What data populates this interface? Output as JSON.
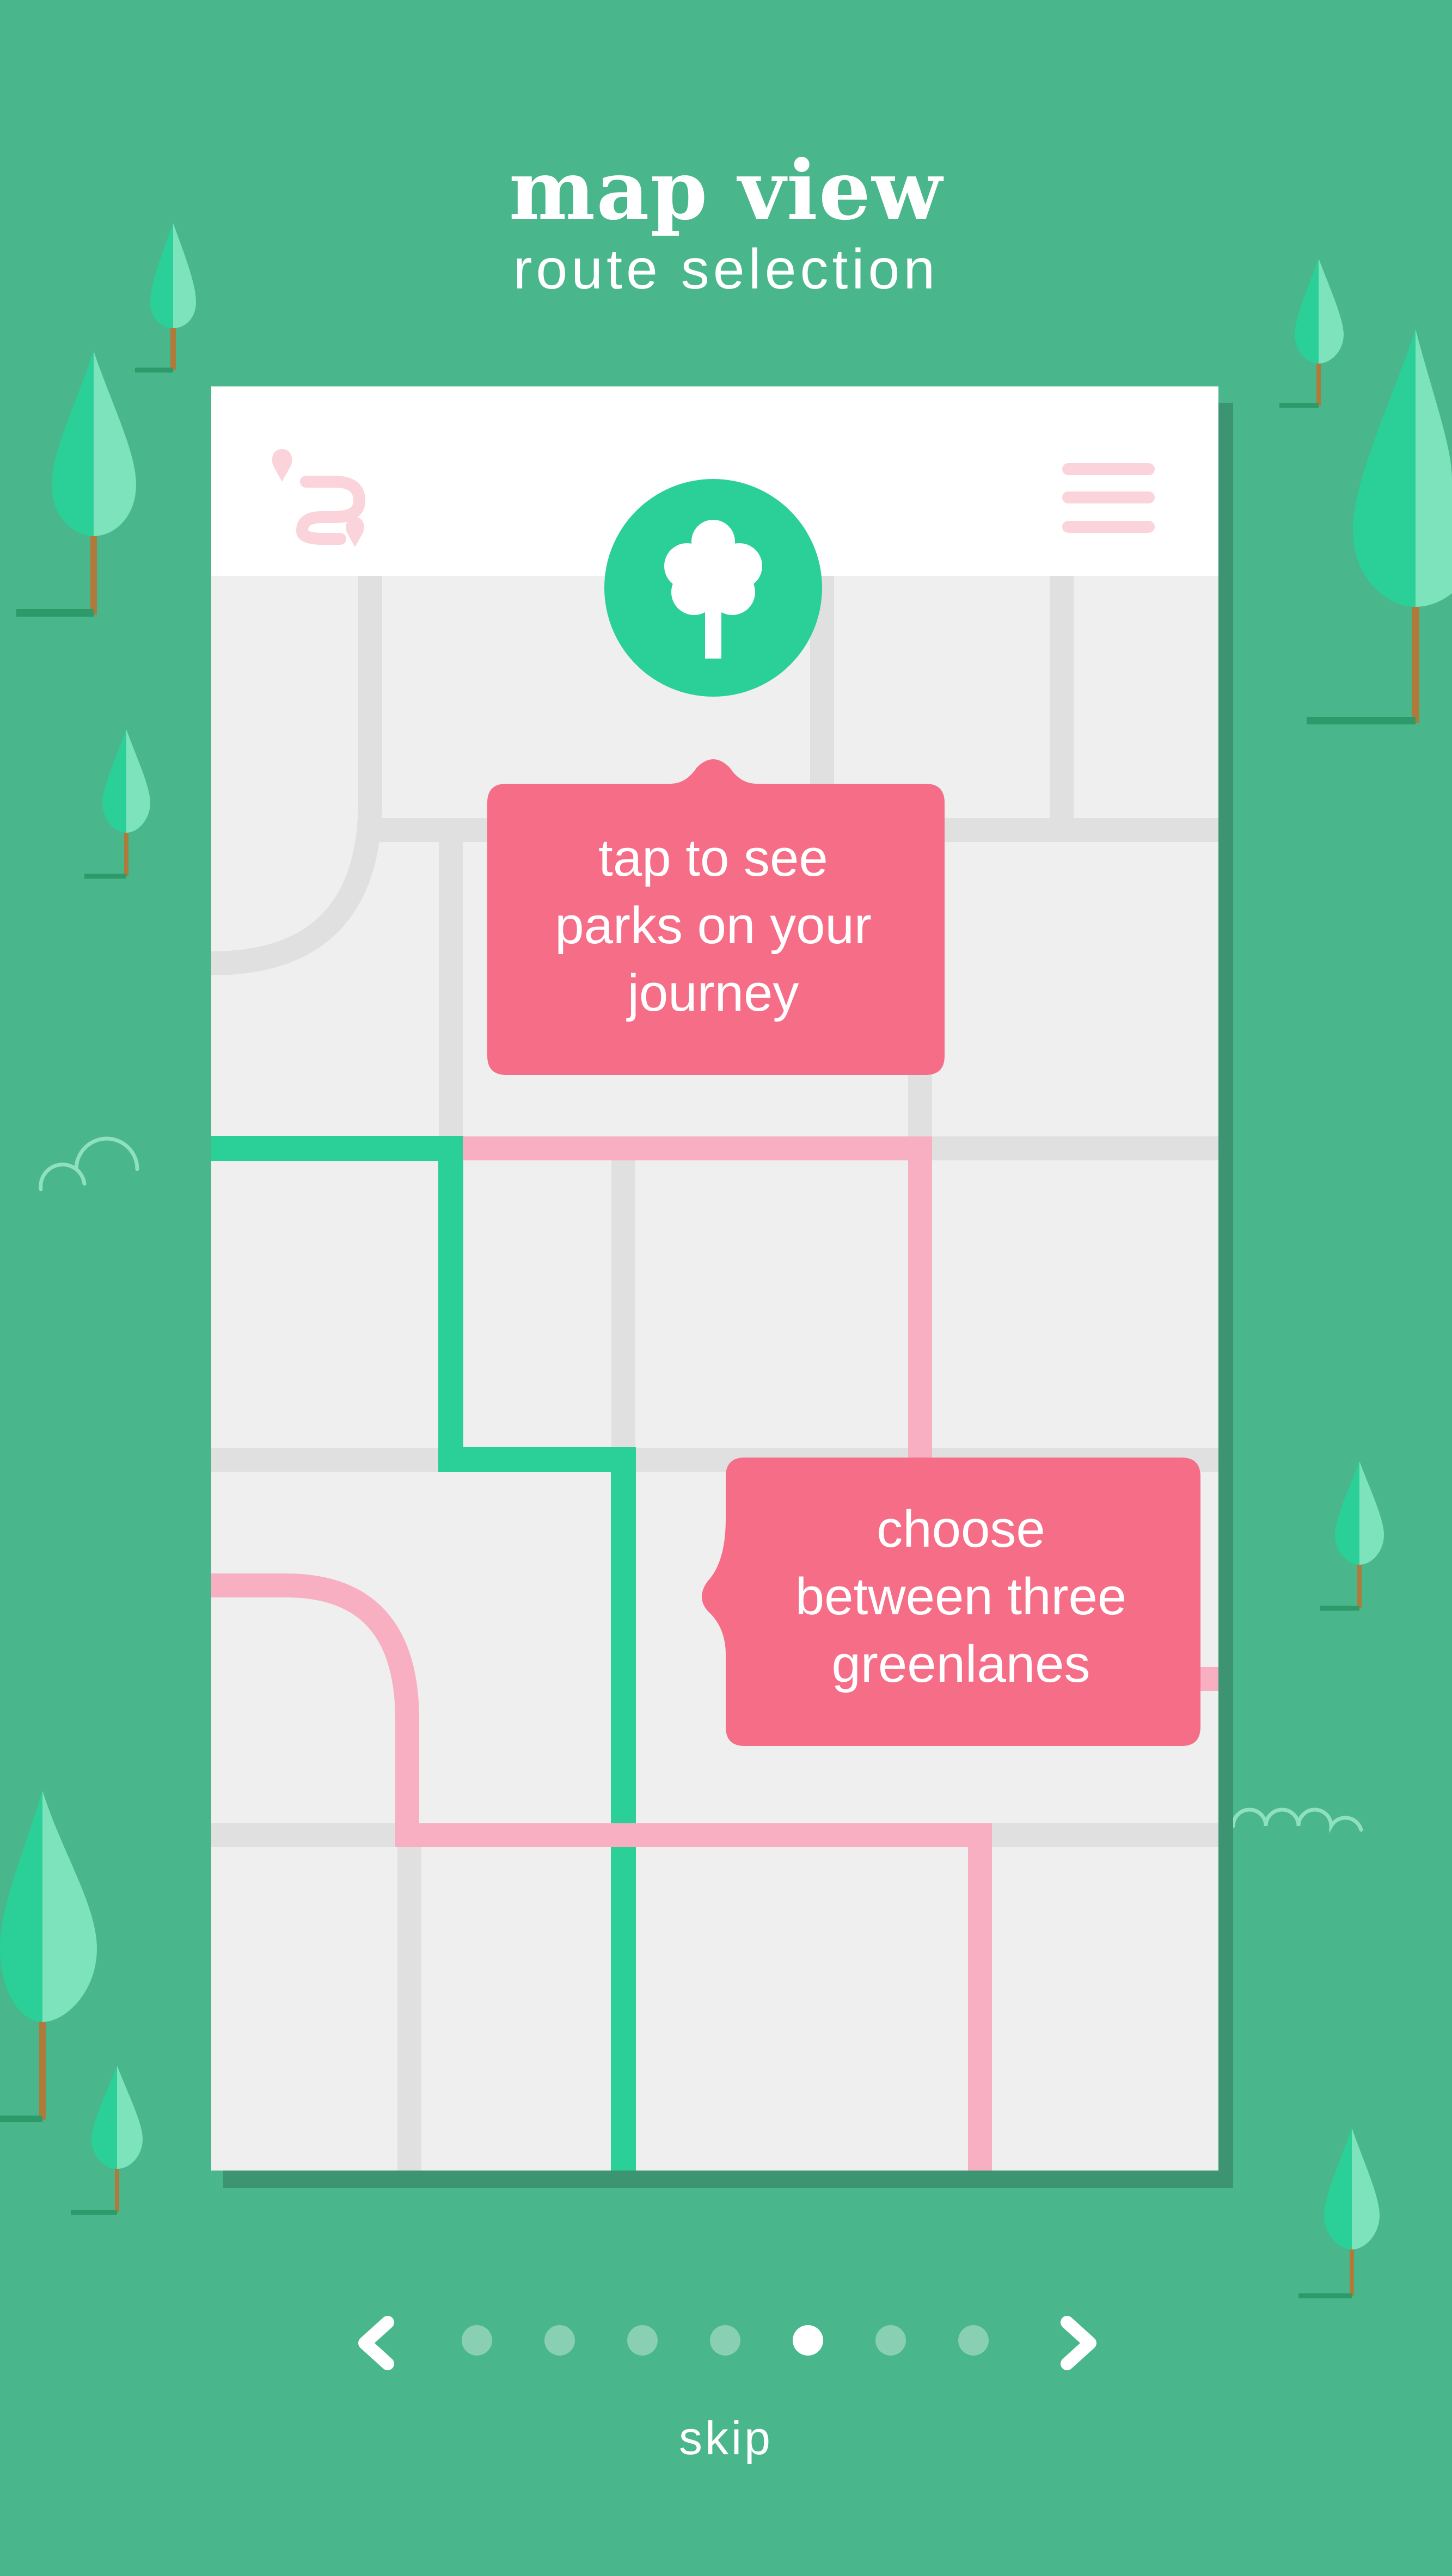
{
  "header": {
    "title": "map view",
    "subtitle": "route selection"
  },
  "app_screen": {
    "logo_icon": "route-logo-icon",
    "menu_icon": "hamburger-menu-icon",
    "park_button_icon": "tree-icon"
  },
  "tooltips": {
    "parks_hint": "tap to see\nparks on your\njourney",
    "routes_hint": "choose\nbetween three\ngreenlanes"
  },
  "pagination": {
    "prev_icon": "chevron-left-icon",
    "next_icon": "chevron-right-icon",
    "total_pages": 7,
    "active_page": 5,
    "skip_label": "skip"
  },
  "colors": {
    "background": "#49b68c",
    "accent_green": "#2bcf98",
    "tooltip_pink": "#f56d86",
    "route_pink": "#f7afc1",
    "map_bg": "#efefef",
    "map_road": "#e0e0e0"
  }
}
